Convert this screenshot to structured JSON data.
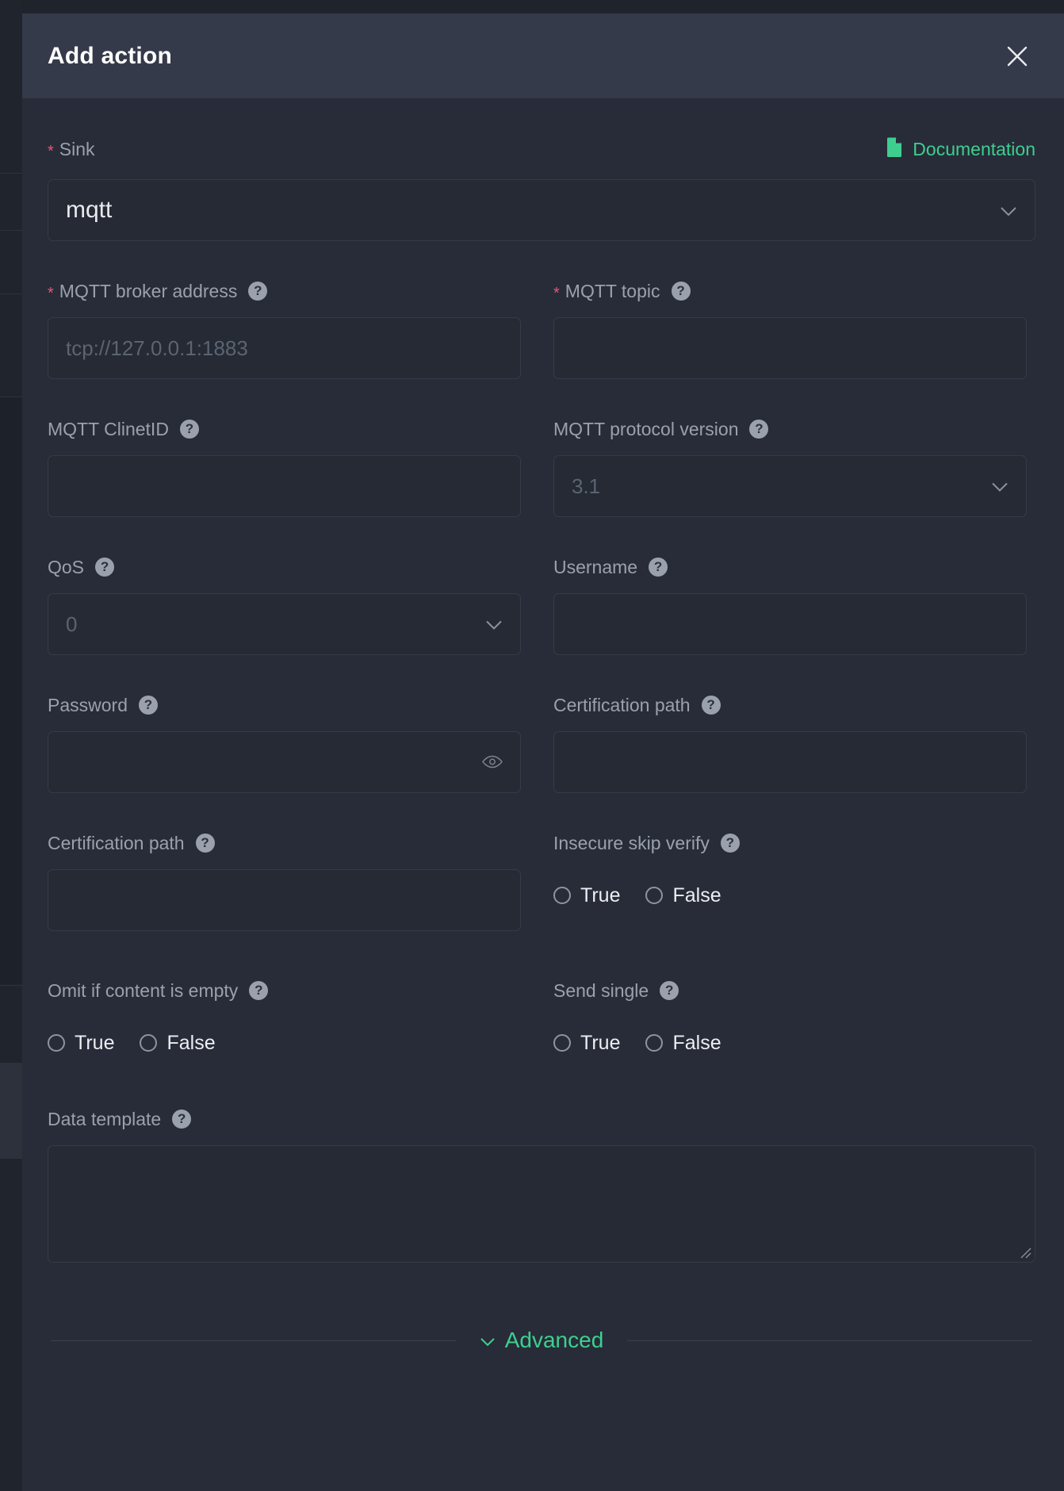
{
  "modal": {
    "title": "Add action",
    "close_icon": "close-icon"
  },
  "sink": {
    "label": "Sink",
    "required_marker": "*",
    "value": "mqtt",
    "documentation_label": "Documentation",
    "documentation_icon": "document-icon",
    "chevron_icon": "chevron-down-icon"
  },
  "fields": {
    "broker_address": {
      "label": "MQTT broker address",
      "required_marker": "*",
      "placeholder": "tcp://127.0.0.1:1883",
      "value": "",
      "help_icon": "question-mark-icon"
    },
    "topic": {
      "label": "MQTT topic",
      "required_marker": "*",
      "placeholder": "",
      "value": "",
      "help_icon": "question-mark-icon"
    },
    "client_id": {
      "label": "MQTT ClinetID",
      "placeholder": "",
      "value": "",
      "help_icon": "question-mark-icon"
    },
    "protocol_version": {
      "label": "MQTT protocol version",
      "placeholder": "3.1",
      "value": "",
      "help_icon": "question-mark-icon",
      "chevron_icon": "chevron-down-icon"
    },
    "qos": {
      "label": "QoS",
      "placeholder": "0",
      "value": "",
      "help_icon": "question-mark-icon",
      "chevron_icon": "chevron-down-icon"
    },
    "username": {
      "label": "Username",
      "placeholder": "",
      "value": "",
      "help_icon": "question-mark-icon"
    },
    "password": {
      "label": "Password",
      "placeholder": "",
      "value": "",
      "help_icon": "question-mark-icon",
      "reveal_icon": "eye-icon"
    },
    "certification_path": {
      "label": "Certification path",
      "placeholder": "",
      "value": "",
      "help_icon": "question-mark-icon"
    },
    "certification_path_2": {
      "label": "Certification path",
      "placeholder": "",
      "value": "",
      "help_icon": "question-mark-icon"
    },
    "insecure_skip_verify": {
      "label": "Insecure skip verify",
      "help_icon": "question-mark-icon",
      "options": [
        "True",
        "False"
      ],
      "selected": ""
    },
    "omit_if_content_is_empty": {
      "label": "Omit if content is empty",
      "help_icon": "question-mark-icon",
      "options": [
        "True",
        "False"
      ],
      "selected": ""
    },
    "send_single": {
      "label": "Send single",
      "help_icon": "question-mark-icon",
      "options": [
        "True",
        "False"
      ],
      "selected": ""
    },
    "data_template": {
      "label": "Data template",
      "placeholder": "",
      "value": "",
      "help_icon": "question-mark-icon"
    }
  },
  "advanced": {
    "label": "Advanced",
    "chevron_icon": "chevron-down-icon"
  },
  "colors": {
    "accent_green": "#3ecf8e",
    "required_red": "#e8547c",
    "modal_body": "#272c38",
    "modal_header": "#353a4a",
    "input_bg": "#252a34",
    "label_text": "#9aa1ad"
  }
}
